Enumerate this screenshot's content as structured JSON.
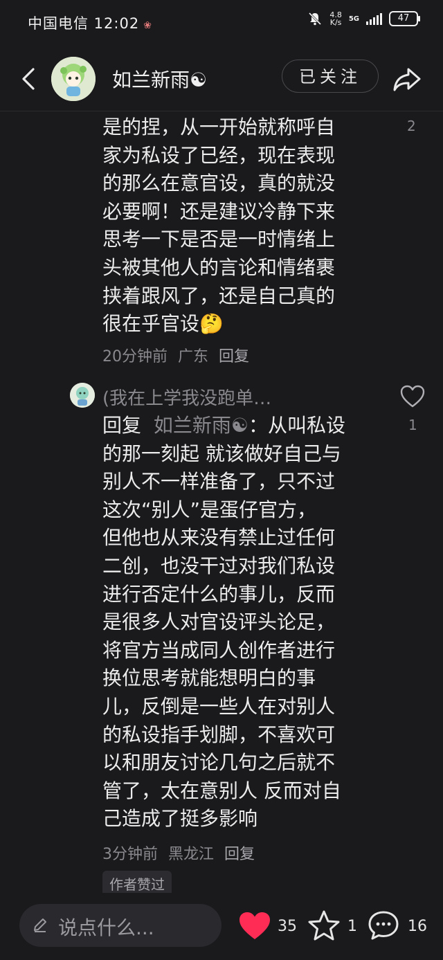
{
  "status_bar": {
    "carrier_time": "中国电信 12:02",
    "net_speed_top": "4.8",
    "net_speed_unit": "K/s",
    "network": "5G",
    "battery": "47"
  },
  "header": {
    "title": "如兰新雨☯",
    "follow_label": "已关注"
  },
  "comment1": {
    "lines": [
      "是的捏，从一开始就称呼自",
      "家为私设了已经，现在表现",
      "的那么在意官设，真的就没",
      "必要啊！还是建议冷静下来",
      "思考一下是否是一时情绪上",
      "头被其他人的言论和情绪裹",
      "挟着跟风了，还是自己真的",
      "很在乎官设🤔"
    ],
    "like_count": "2",
    "time": "20分钟前",
    "location": "广东",
    "reply": "回复"
  },
  "comment2": {
    "username": "(我在上学我没跑单…",
    "reply_prefix": "回复",
    "mention": "如兰新雨☯",
    "first_line_rest": "：从叫私设",
    "lines": [
      "的那一刻起 就该做好自己与",
      "别人不一样准备了，只不过",
      "这次“别人”是蛋仔官方，",
      "但他也从来没有禁止过任何",
      "二创，也没干过对我们私设",
      "进行否定什么的事儿，反而",
      "是很多人对官设评头论足，",
      "将官方当成同人创作者进行",
      "换位思考就能想明白的事",
      "儿，反倒是一些人在对别人",
      "的私设指手划脚，不喜欢可",
      "以和朋友讨论几句之后就不",
      "管了，太在意别人 反而对自",
      "己造成了挺多影响"
    ],
    "like_count": "1",
    "time": "3分钟前",
    "location": "黑龙江",
    "reply": "回复",
    "author_liked": "作者赞过"
  },
  "bottom_bar": {
    "input_placeholder": "说点什么...",
    "like_count": "35",
    "fav_count": "1",
    "comment_count": "16"
  },
  "icons": {
    "heart_fill_color": "#ff2d55"
  }
}
